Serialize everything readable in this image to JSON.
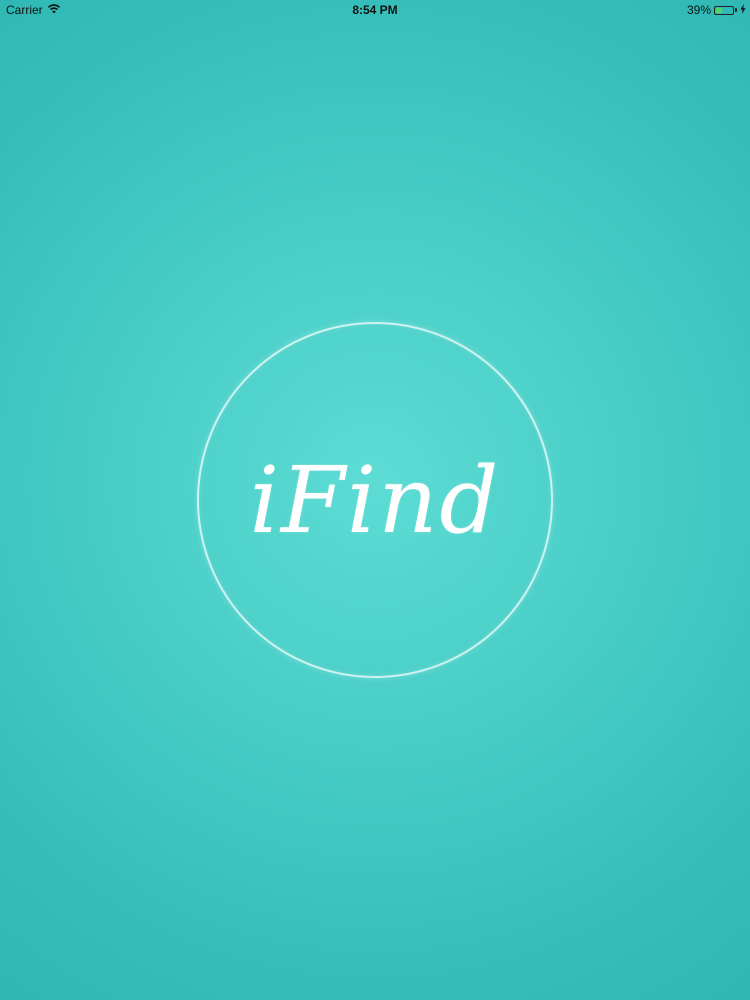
{
  "status_bar": {
    "carrier": "Carrier",
    "time": "8:54 PM",
    "battery_percent": "39%",
    "battery_level": 0.39,
    "wifi_icon": "wifi-icon",
    "battery_icon": "battery-icon",
    "charging_icon": "charging-bolt-icon"
  },
  "splash": {
    "logo_text": "iFind"
  },
  "colors": {
    "background_center": "#5cdcd4",
    "background_edge": "#2cb3b0",
    "logo": "#ffffff",
    "battery_fill": "#4cd964"
  }
}
